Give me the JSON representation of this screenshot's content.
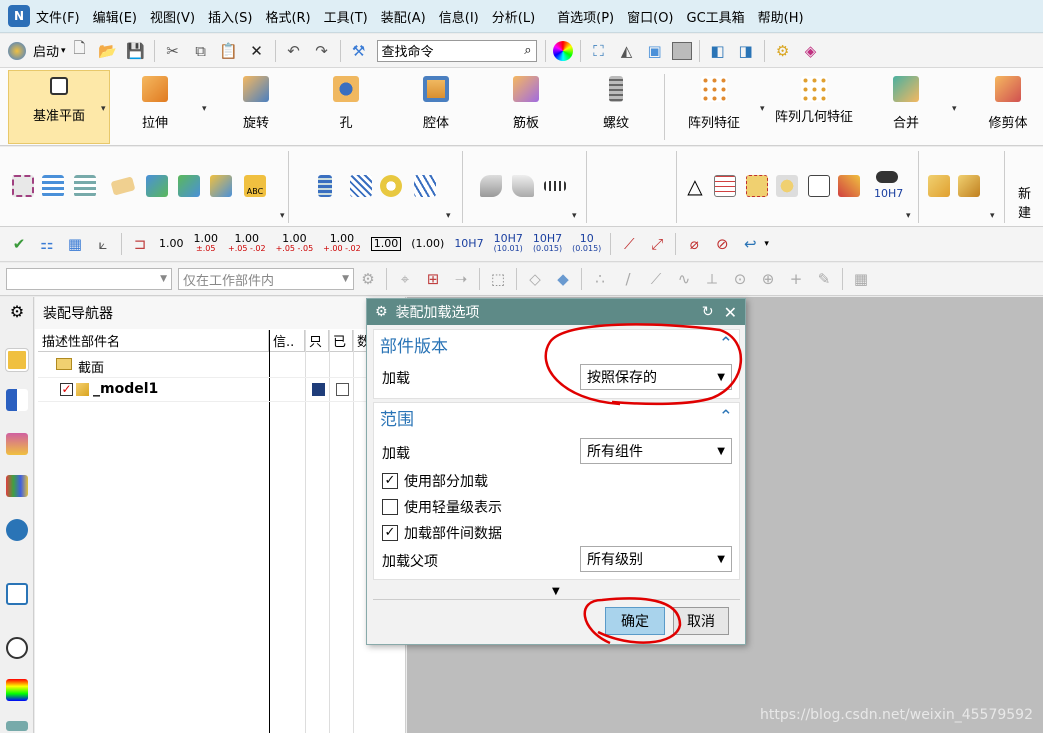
{
  "menubar": {
    "items": [
      "文件(F)",
      "编辑(E)",
      "视图(V)",
      "插入(S)",
      "格式(R)",
      "工具(T)",
      "装配(A)",
      "信息(I)",
      "分析(L)",
      "首选项(P)",
      "窗口(O)",
      "GC工具箱",
      "帮助(H)"
    ]
  },
  "stdbar": {
    "start_label": "启动",
    "search_placeholder": "查找命令"
  },
  "ribbon": {
    "buttons": [
      "基准平面",
      "拉伸",
      "旋转",
      "孔",
      "腔体",
      "筋板",
      "螺纹",
      "阵列特征",
      "阵列几何特征",
      "合并",
      "修剪体"
    ],
    "new_label": "新建"
  },
  "dimbar": {
    "values": [
      "1.00",
      "1.00",
      "1.00",
      "1.00",
      "1.00",
      "1.00",
      "(1.00)",
      "10H7",
      "10H7",
      "10H7",
      "10"
    ]
  },
  "filterbar": {
    "scope_placeholder": "仅在工作部件内"
  },
  "navigator": {
    "title": "装配导航器",
    "columns": [
      "描述性部件名",
      "信..",
      "只",
      "已",
      "数"
    ],
    "nodes": [
      "截面",
      "_model1"
    ]
  },
  "dialog": {
    "title": "装配加载选项",
    "section1": {
      "title": "部件版本",
      "load_label": "加载",
      "load_value": "按照保存的"
    },
    "section2": {
      "title": "范围",
      "load_label": "加载",
      "load_value": "所有组件",
      "opt_partial": "使用部分加载",
      "opt_lightweight": "使用轻量级表示",
      "opt_interpart": "加载部件间数据",
      "parent_label": "加载父项",
      "parent_value": "所有级别"
    },
    "ok_label": "确定",
    "cancel_label": "取消"
  },
  "watermark": "https://blog.csdn.net/weixin_45579592",
  "colors": {
    "dialog_title_bg": "#5e8a87",
    "section_title": "#2a74b6",
    "annotation_red": "#e00000",
    "ok_button_bg": "#a9d3ec",
    "selected_tool_bg": "#fde8a8"
  }
}
